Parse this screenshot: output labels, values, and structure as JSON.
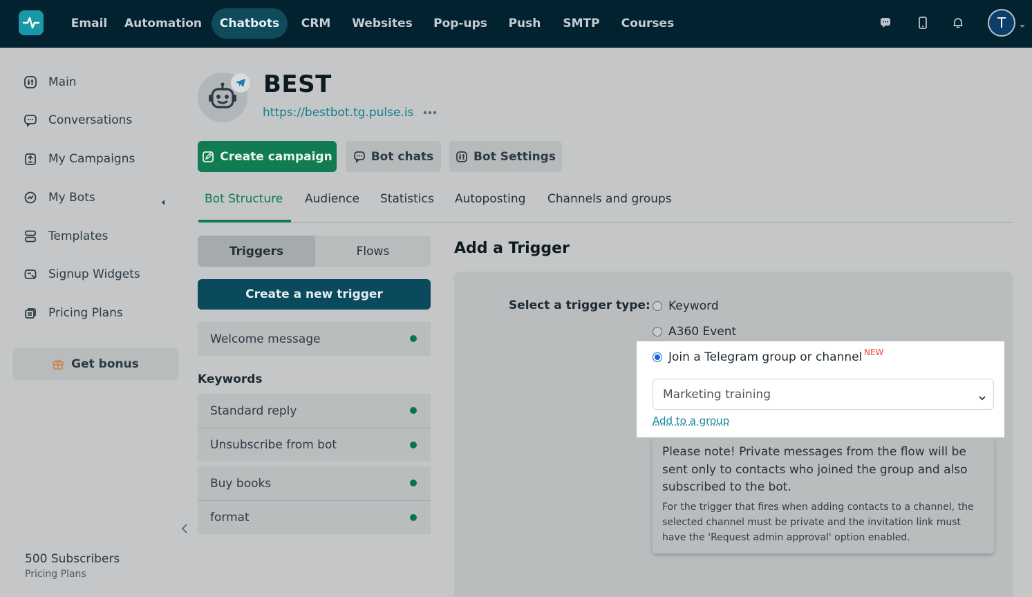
{
  "topnav": {
    "items": [
      "Email",
      "Automation",
      "Chatbots",
      "CRM",
      "Websites",
      "Pop-ups",
      "Push",
      "SMTP",
      "Courses"
    ],
    "active": "Chatbots",
    "avatar_letter": "T"
  },
  "sidebar": {
    "items": [
      {
        "label": "Main",
        "icon": "sliders-icon"
      },
      {
        "label": "Conversations",
        "icon": "chat-bubble-icon"
      },
      {
        "label": "My Campaigns",
        "icon": "campaign-icon"
      },
      {
        "label": "My Bots",
        "icon": "bot-icon"
      },
      {
        "label": "Templates",
        "icon": "templates-icon"
      },
      {
        "label": "Signup Widgets",
        "icon": "widget-icon"
      },
      {
        "label": "Pricing Plans",
        "icon": "pricing-icon"
      }
    ],
    "bonus_label": "Get bonus",
    "subscribers": "500 Subscribers",
    "pricing_link": "Pricing Plans"
  },
  "bot": {
    "name": "BEST",
    "url": "https://bestbot.tg.pulse.is"
  },
  "actions": {
    "create_campaign": "Create campaign",
    "bot_chats": "Bot chats",
    "bot_settings": "Bot Settings"
  },
  "tabs": [
    "Bot Structure",
    "Audience",
    "Statistics",
    "Autoposting",
    "Channels and groups"
  ],
  "segment": {
    "triggers": "Triggers",
    "flows": "Flows"
  },
  "triggers": {
    "create_label": "Create a new trigger",
    "welcome": "Welcome message",
    "keywords_heading": "Keywords",
    "group1": [
      "Standard reply",
      "Unsubscribe from bot"
    ],
    "group2": [
      "Buy books",
      "format"
    ]
  },
  "panel": {
    "title": "Add a Trigger",
    "select_label": "Select a trigger type:",
    "options": [
      "Keyword",
      "A360 Event",
      "Join a Telegram group or channel"
    ],
    "selected_option": "Join a Telegram group or channel",
    "new_badge": "NEW",
    "dropdown_value": "Marketing training",
    "add_group_link": "Add to a group",
    "note_main": "Please note! Private messages from the flow will be sent only to contacts who joined the group and also subscribed to the bot.",
    "note_sub": "For the trigger that fires when adding contacts to a channel, the selected channel must be private and the invitation link must have the 'Request admin approval' option enabled."
  },
  "colors": {
    "topbar": "#03222f",
    "accent_green": "#107a51",
    "primary_dark": "#0b4a5c",
    "link": "#127e8f",
    "new_badge": "#e64a2e"
  }
}
